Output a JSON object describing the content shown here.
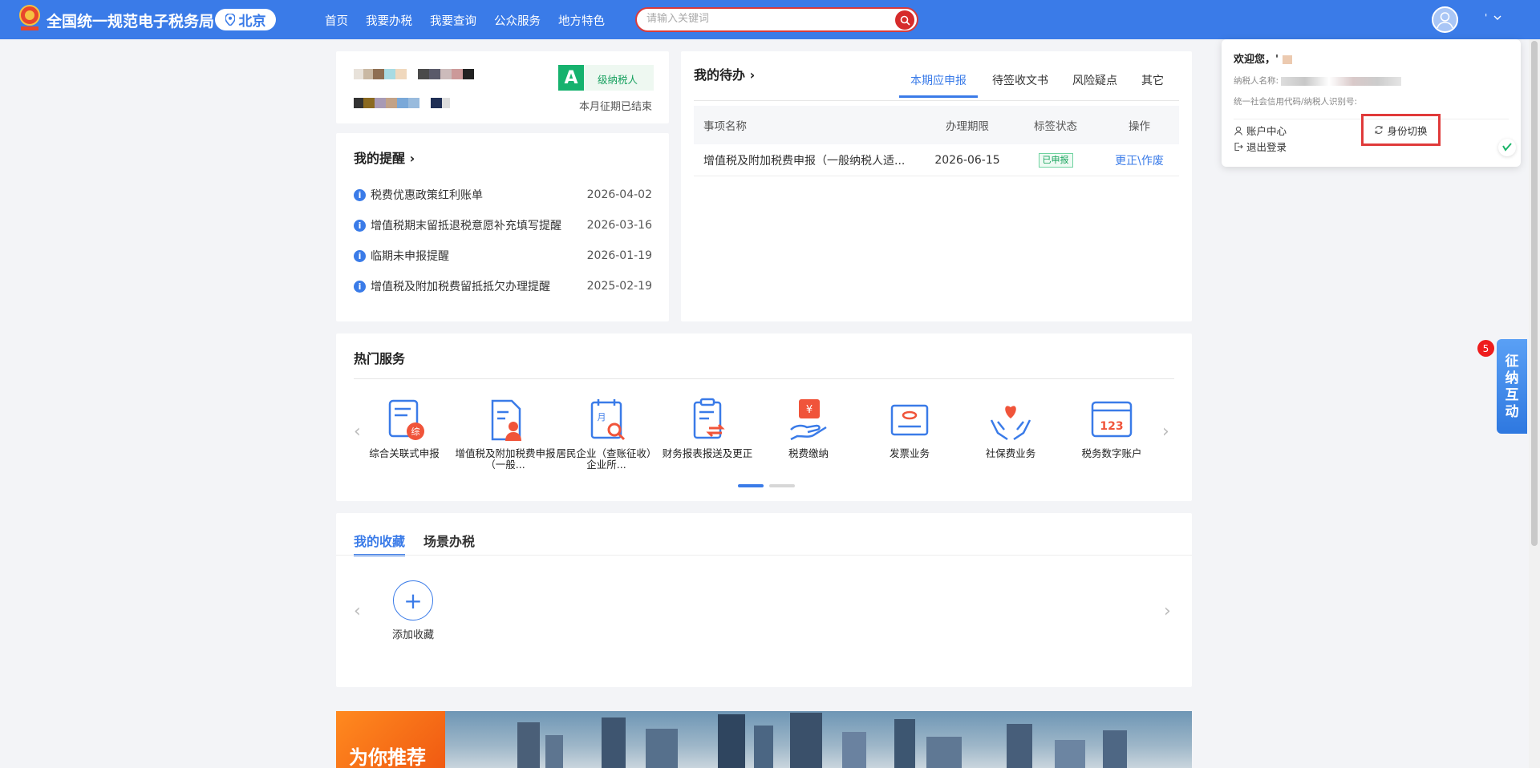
{
  "header": {
    "site_title": "全国统一规范电子税务局",
    "city": "北京",
    "nav": [
      "首页",
      "我要办税",
      "我要查询",
      "公众服务",
      "地方特色"
    ],
    "search_placeholder": "请输入关键词",
    "user_initial": "'",
    "colors": {
      "bar": "#3a7be8",
      "search_border": "#d83b3b"
    }
  },
  "profile": {
    "grade": "A",
    "grade_label": "级纳税人",
    "period_status": "本月征期已结束"
  },
  "reminders": {
    "title": "我的提醒",
    "items": [
      {
        "text": "税费优惠政策红利账单",
        "date": "2026-04-02"
      },
      {
        "text": "增值税期末留抵退税意愿补充填写提醒",
        "date": "2026-03-16"
      },
      {
        "text": "临期未申报提醒",
        "date": "2026-01-19"
      },
      {
        "text": "增值税及附加税费留抵抵欠办理提醒",
        "date": "2025-02-19"
      }
    ]
  },
  "todo": {
    "title": "我的待办",
    "tabs": [
      "本期应申报",
      "待签收文书",
      "风险疑点",
      "其它"
    ],
    "active_tab": "本期应申报",
    "columns": [
      "事项名称",
      "办理期限",
      "标签状态",
      "操作"
    ],
    "rows": [
      {
        "name": "增值税及附加税费申报（一般纳税人适...",
        "deadline": "2026-06-15",
        "status": "已申报",
        "action": "更正\\作废"
      }
    ]
  },
  "hot_services": {
    "title": "热门服务",
    "items": [
      {
        "label": "综合关联式申报",
        "icon": "comprehensive-report-icon"
      },
      {
        "label": "增值税及附加税费申报（一般...",
        "icon": "vat-report-icon"
      },
      {
        "label": "居民企业（查账征收）企业所...",
        "icon": "corporate-income-tax-icon"
      },
      {
        "label": "财务报表报送及更正",
        "icon": "financial-statement-icon"
      },
      {
        "label": "税费缴纳",
        "icon": "tax-payment-icon"
      },
      {
        "label": "发票业务",
        "icon": "invoice-icon"
      },
      {
        "label": "社保费业务",
        "icon": "social-security-icon"
      },
      {
        "label": "税务数字账户",
        "icon": "digital-account-icon"
      }
    ],
    "page": 1,
    "page_count": 2
  },
  "favorites": {
    "tabs": [
      "我的收藏",
      "场景办税"
    ],
    "active_tab": "我的收藏",
    "add_label": "添加收藏"
  },
  "banner": {
    "title": "为你推荐"
  },
  "user_popup": {
    "welcome": "欢迎您，'",
    "taxpayer_name_label": "纳税人名称:",
    "credit_code_label": "统一社会信用代码/纳税人识别号:",
    "account_center": "账户中心",
    "logout": "退出登录",
    "switch_identity": "身份切换"
  },
  "side_float": {
    "label": [
      "征",
      "纳",
      "互",
      "动"
    ],
    "badge_count": "5"
  }
}
